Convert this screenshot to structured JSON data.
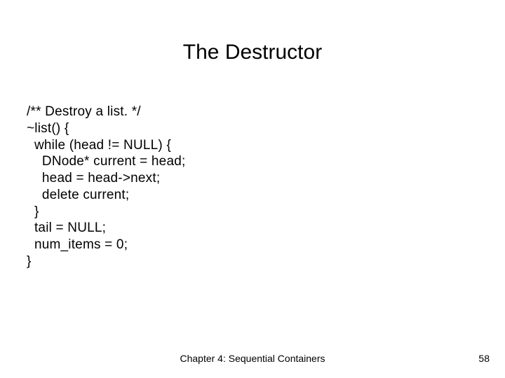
{
  "slide": {
    "title": "The Destructor",
    "code": "/** Destroy a list. */\n~list() {\n  while (head != NULL) {\n    DNode* current = head;\n    head = head->next;\n    delete current;\n  }\n  tail = NULL;\n  num_items = 0;\n}",
    "footer": {
      "chapter": "Chapter 4: Sequential Containers",
      "page": "58"
    }
  }
}
